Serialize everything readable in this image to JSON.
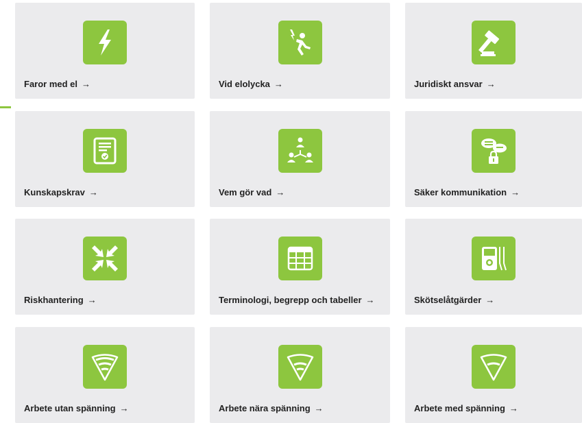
{
  "cards": [
    {
      "label": "Faror med el",
      "icon": "lightning-icon"
    },
    {
      "label": "Vid elolycka",
      "icon": "electrocution-fall-icon"
    },
    {
      "label": "Juridiskt ansvar",
      "icon": "gavel-icon"
    },
    {
      "label": "Kunskapskrav",
      "icon": "certificate-icon"
    },
    {
      "label": "Vem gör vad",
      "icon": "people-hierarchy-icon"
    },
    {
      "label": "Säker kommunikation",
      "icon": "speech-lock-icon"
    },
    {
      "label": "Riskhantering",
      "icon": "compress-arrows-icon"
    },
    {
      "label": "Terminologi, begrepp och tabeller",
      "icon": "table-icon"
    },
    {
      "label": "Skötselåtgärder",
      "icon": "multimeter-icon"
    },
    {
      "label": "Arbete utan spänning",
      "icon": "voltage-zone-none-icon"
    },
    {
      "label": "Arbete nära spänning",
      "icon": "voltage-zone-near-icon"
    },
    {
      "label": "Arbete med spänning",
      "icon": "voltage-zone-live-icon"
    }
  ],
  "arrow_glyph": "→",
  "colors": {
    "accent": "#8dc63f",
    "card_bg": "#ebebed",
    "text": "#222222"
  }
}
